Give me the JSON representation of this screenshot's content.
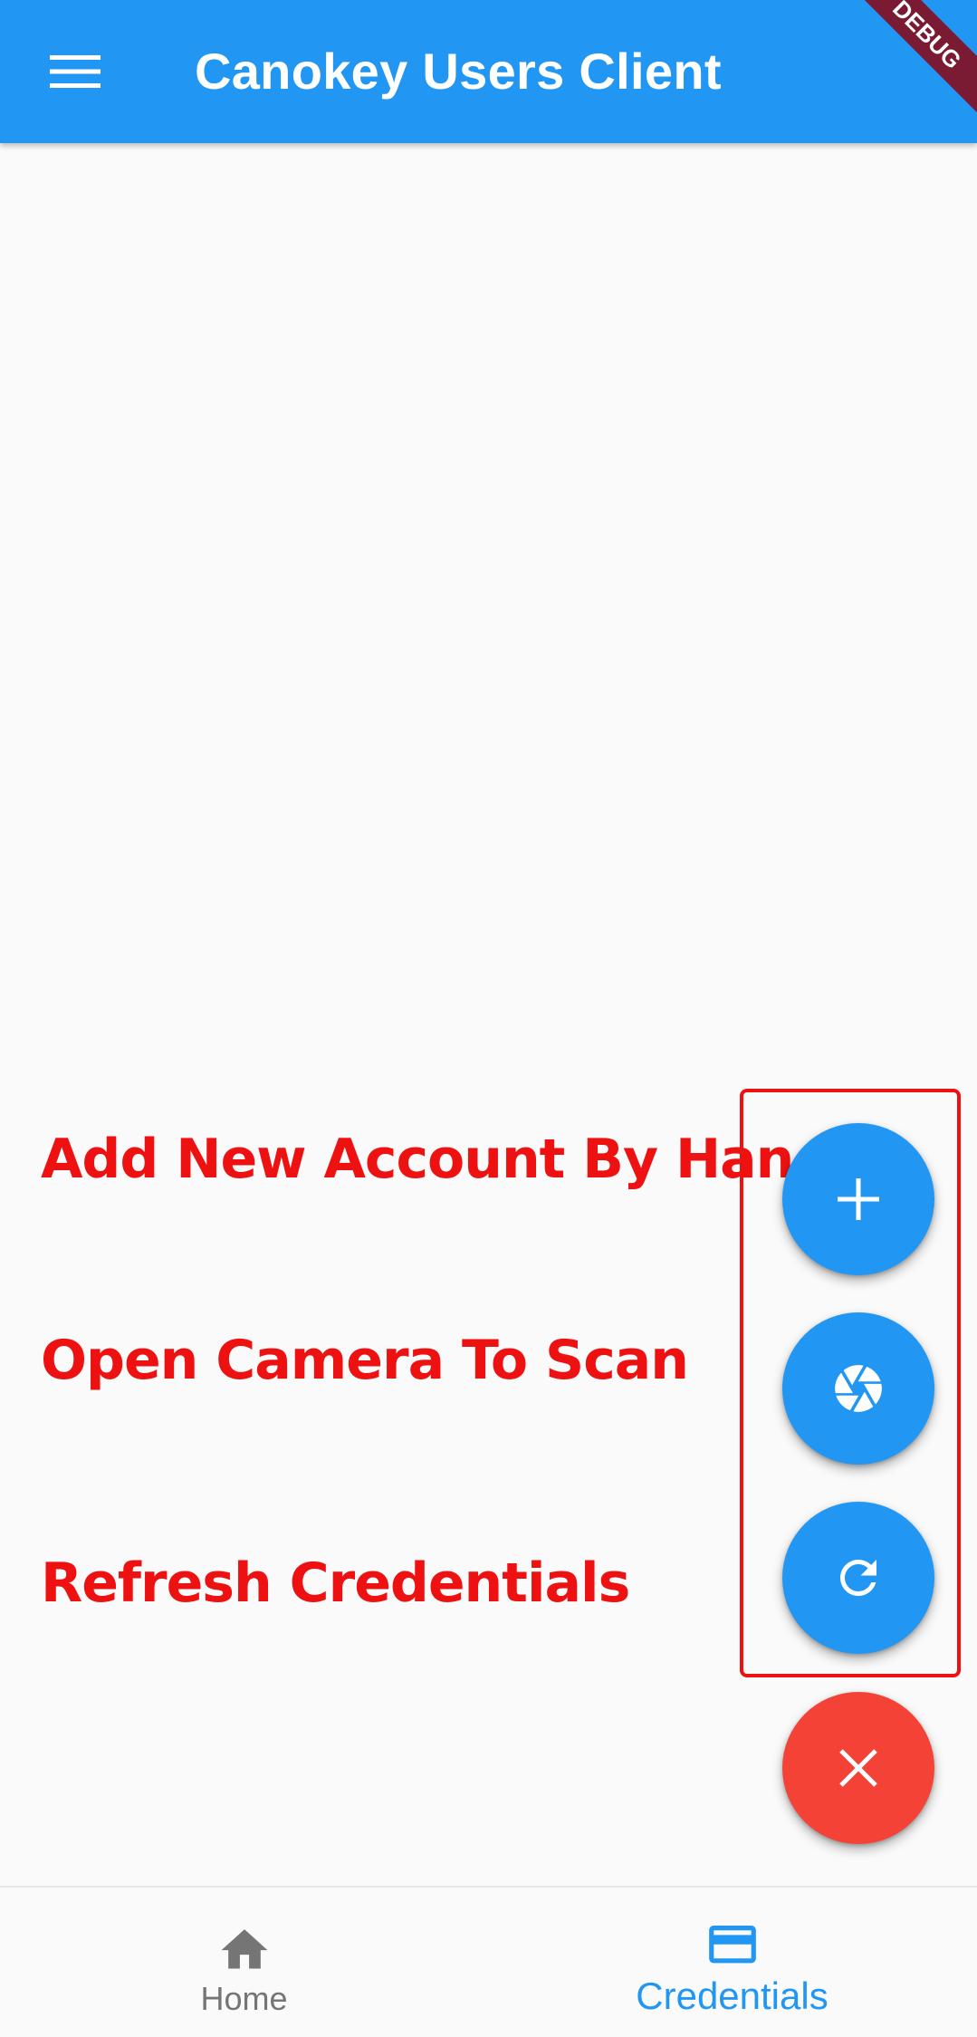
{
  "app_bar": {
    "title": "Canokey Users Client",
    "menu_icon": "menu-icon",
    "color": "#2196f3"
  },
  "debug_banner": {
    "label": "DEBUG",
    "color": "#7b1a33"
  },
  "annotations": {
    "add_by_hand": "Add New Account By Hand",
    "open_camera": "Open Camera To Scan",
    "refresh": "Refresh Credentials",
    "color": "#ee1111"
  },
  "fabs": [
    {
      "icon": "add-icon",
      "color": "#2196f3"
    },
    {
      "icon": "camera-aperture-icon",
      "color": "#2196f3"
    },
    {
      "icon": "refresh-icon",
      "color": "#2196f3"
    },
    {
      "icon": "close-icon",
      "color": "#f44336"
    }
  ],
  "bottom_nav": {
    "items": [
      {
        "label": "Home",
        "icon": "home-icon",
        "active": false
      },
      {
        "label": "Credentials",
        "icon": "credit-card-icon",
        "active": true
      }
    ],
    "active_color": "#2196f3",
    "inactive_color": "#757575"
  }
}
